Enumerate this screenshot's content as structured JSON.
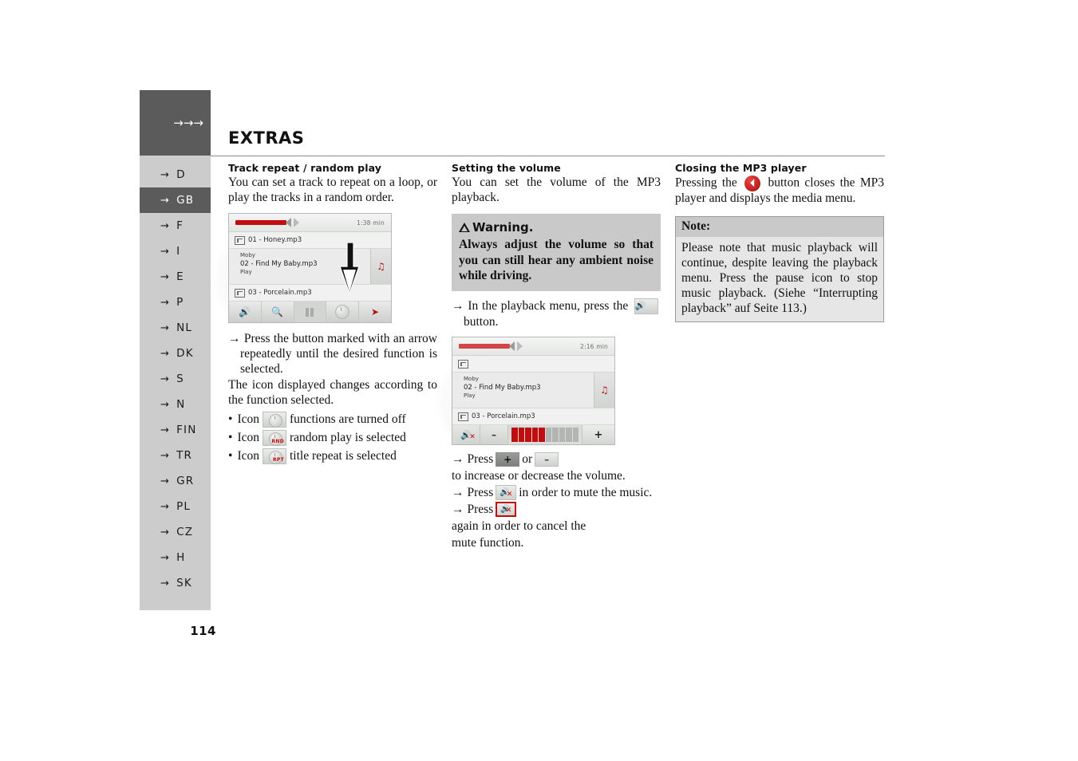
{
  "document": {
    "chapter_title": "EXTRAS",
    "page_number": "114",
    "header_arrows": "→→→"
  },
  "sidebar": {
    "languages": [
      {
        "code": "D",
        "active": false
      },
      {
        "code": "GB",
        "active": true
      },
      {
        "code": "F",
        "active": false
      },
      {
        "code": "I",
        "active": false
      },
      {
        "code": "E",
        "active": false
      },
      {
        "code": "P",
        "active": false
      },
      {
        "code": "NL",
        "active": false
      },
      {
        "code": "DK",
        "active": false
      },
      {
        "code": "S",
        "active": false
      },
      {
        "code": "N",
        "active": false
      },
      {
        "code": "FIN",
        "active": false
      },
      {
        "code": "TR",
        "active": false
      },
      {
        "code": "GR",
        "active": false
      },
      {
        "code": "PL",
        "active": false
      },
      {
        "code": "CZ",
        "active": false
      },
      {
        "code": "H",
        "active": false
      },
      {
        "code": "SK",
        "active": false
      }
    ],
    "arrow_glyph": "→"
  },
  "column_left": {
    "heading": "Track repeat / random play",
    "intro": "You can set a track to repeat on a loop, or play the tracks in a random order.",
    "instruction": "Press the button marked with an arrow repeatedly until the desired function is selected.",
    "note_line": "The icon displayed changes according to the function selected.",
    "bullets": [
      {
        "prefix": "Icon",
        "icon_label": "",
        "text": "functions are turned off"
      },
      {
        "prefix": "Icon",
        "icon_label": "RND",
        "text": "random play is selected"
      },
      {
        "prefix": "Icon",
        "icon_label": "RPT",
        "text": "title repeat is selected"
      }
    ],
    "bullet_dot": "•",
    "arrow_glyph": "→"
  },
  "column_middle": {
    "heading": "Setting the volume",
    "intro": "You can set the volume of the MP3 playback.",
    "warning": {
      "title": "Warning.",
      "body": "Always adjust the volume so that you can still hear any ambient noise while driving."
    },
    "step_press_button_pre": "In the playback menu, press the",
    "step_press_button_post": "button.",
    "steps": [
      {
        "pre": "Press",
        "mid": "or",
        "post": "to increase or decrease the volume.",
        "icon_a": "+",
        "icon_b": "–"
      },
      {
        "pre": "Press",
        "post": "in order to mute the music."
      },
      {
        "pre": "Press",
        "post": "again in order to cancel the mute function."
      }
    ],
    "arrow_glyph": "→"
  },
  "column_right": {
    "heading": "Closing the MP3 player",
    "text_before_icon": "Pressing the",
    "text_after_icon": "button closes the MP3 player and displays the media menu.",
    "note": {
      "title": "Note:",
      "body": "Please note that music playback will continue, despite leaving the playback menu. Press the pause icon to stop music playback. (Siehe “Interrupting playback” auf Seite 113.)"
    }
  },
  "device_screenshot_1": {
    "time_remaining": "1:38 min",
    "tracks": [
      {
        "label": "01 - Honey.mp3"
      },
      {
        "label": "03 - Porcelain.mp3"
      }
    ],
    "now_playing": {
      "artist": "Moby",
      "title": "02 - Find My Baby.mp3",
      "state": "Play"
    },
    "toolbar_icons": [
      "speaker-icon",
      "search-icon",
      "pause-icon",
      "repeat-knob-icon",
      "exit-icon"
    ]
  },
  "device_screenshot_2": {
    "time_remaining": "2:16 min",
    "tracks": [
      {
        "label": "03 - Porcelain.mp3"
      }
    ],
    "now_playing": {
      "artist": "Moby",
      "title": "02 - Find My Baby.mp3",
      "state": "Play"
    },
    "volume": {
      "segments_total": 10,
      "segments_filled": 5,
      "mute_label": "mute-icon",
      "minus_label": "–",
      "plus_label": "+"
    }
  },
  "colors": {
    "sidebar_bg": "#cccccc",
    "sidebar_active": "#5b5b5b",
    "accent_red": "#c00d0d",
    "box_gray": "#c9c9c9",
    "note_body": "#e6e6e6"
  }
}
